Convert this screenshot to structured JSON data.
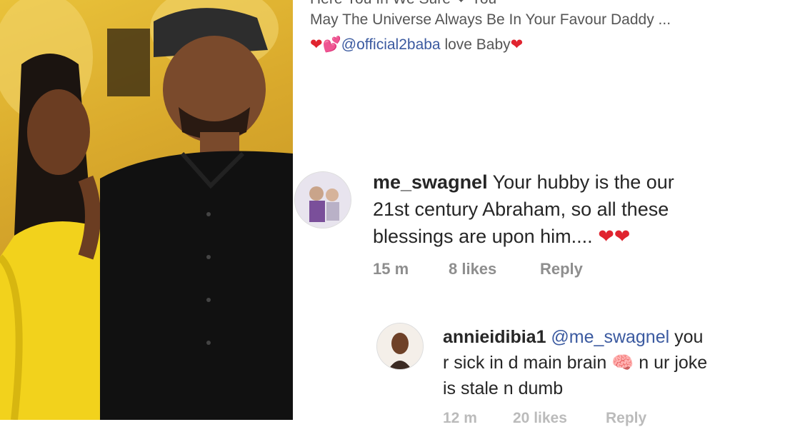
{
  "post": {
    "prev_line_top": "Here You In We Sure ❤ You",
    "prev_line_1": "May The Universe Always Be In Your Favour Daddy ...",
    "prev_line_2_hearts": "❤💕",
    "prev_line_2_mention": "@official2baba",
    "prev_line_2_text": " love Baby",
    "prev_line_2_heart": "❤"
  },
  "comments": [
    {
      "username": "me_swagnel",
      "text_line1": " Your hubby is the our",
      "text_line2": "21st century Abraham,  so all these",
      "text_line3": "blessings are upon him....",
      "hearts": "❤❤",
      "time": "15 m",
      "likes": "8 likes",
      "reply": "Reply"
    },
    {
      "username": "annieidibia1",
      "mention": " @me_swagnel",
      "text_line1_end": " you",
      "text_line2_a": "r sick in d main brain ",
      "brain_emoji": "🧠",
      "text_line2_b": " n ur joke",
      "text_line3": "is stale n dumb",
      "time": "12 m",
      "likes": "20 likes",
      "reply": "Reply"
    }
  ],
  "colors": {
    "heart": "#e0242f",
    "mention": "#3b5aa0",
    "meta": "#8e8e8e"
  }
}
